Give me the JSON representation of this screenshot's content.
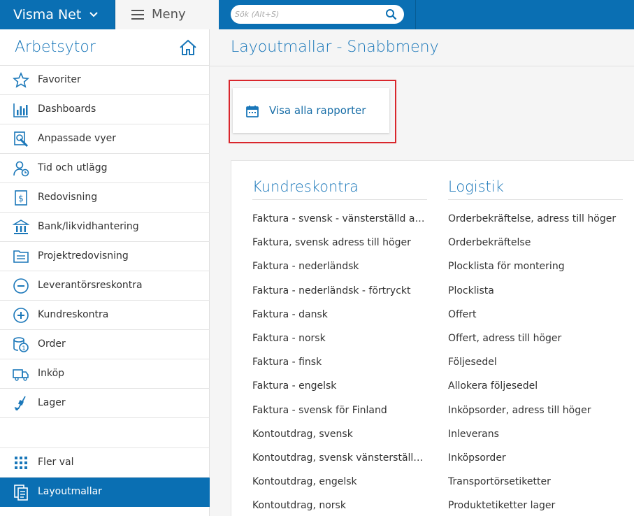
{
  "header": {
    "brand": "Visma Net",
    "menu_label": "Meny",
    "search_placeholder": "Sök (Alt+S)"
  },
  "sidebar": {
    "title": "Arbetsytor",
    "items": [
      {
        "label": "Favoriter",
        "icon": "star-icon"
      },
      {
        "label": "Dashboards",
        "icon": "bar-chart-icon"
      },
      {
        "label": "Anpassade vyer",
        "icon": "custom-view-icon"
      },
      {
        "label": "Tid och utlägg",
        "icon": "time-expense-icon"
      },
      {
        "label": "Redovisning",
        "icon": "ledger-icon"
      },
      {
        "label": "Bank/likvidhantering",
        "icon": "bank-icon"
      },
      {
        "label": "Projektredovisning",
        "icon": "folder-icon"
      },
      {
        "label": "Leverantörsreskontra",
        "icon": "minus-circle-icon"
      },
      {
        "label": "Kundreskontra",
        "icon": "plus-circle-icon"
      },
      {
        "label": "Order",
        "icon": "order-icon"
      },
      {
        "label": "Inköp",
        "icon": "truck-icon"
      },
      {
        "label": "Lager",
        "icon": "hand-truck-icon"
      }
    ],
    "bottom_items": [
      {
        "label": "Fler val",
        "icon": "grid-icon"
      },
      {
        "label": "Layoutmallar",
        "icon": "layout-template-icon"
      }
    ]
  },
  "main": {
    "title": "Layoutmallar - Snabbmeny",
    "show_all_label": "Visa alla rapporter",
    "columns": [
      {
        "heading": "Kundreskontra",
        "items": [
          "Faktura - svensk - vänsterställd adress",
          "Faktura, svensk adress till höger",
          "Faktura - nederländsk",
          "Faktura - nederländsk - förtryckt",
          "Faktura - dansk",
          "Faktura - norsk",
          "Faktura - finsk",
          "Faktura - engelsk",
          "Faktura - svensk för Finland",
          "Kontoutdrag, svensk",
          "Kontoutdrag, svensk vänsterställd adress",
          "Kontoutdrag, engelsk",
          "Kontoutdrag, norsk"
        ],
        "starred_index": 1
      },
      {
        "heading": "Logistik",
        "items": [
          "Orderbekräftelse, adress till höger",
          "Orderbekräftelse",
          "Plocklista för montering",
          "Plocklista",
          "Offert",
          "Offert, adress till höger",
          "Följesedel",
          "Allokera följesedel",
          "Inköpsorder, adress till höger",
          "Inleverans",
          "Inköpsorder",
          "Transportörsetiketter",
          "Produktetiketter lager"
        ]
      }
    ]
  },
  "colors": {
    "primary": "#0a6fb3",
    "title_blue": "#1a77b9",
    "highlight_red": "#d9262c"
  }
}
